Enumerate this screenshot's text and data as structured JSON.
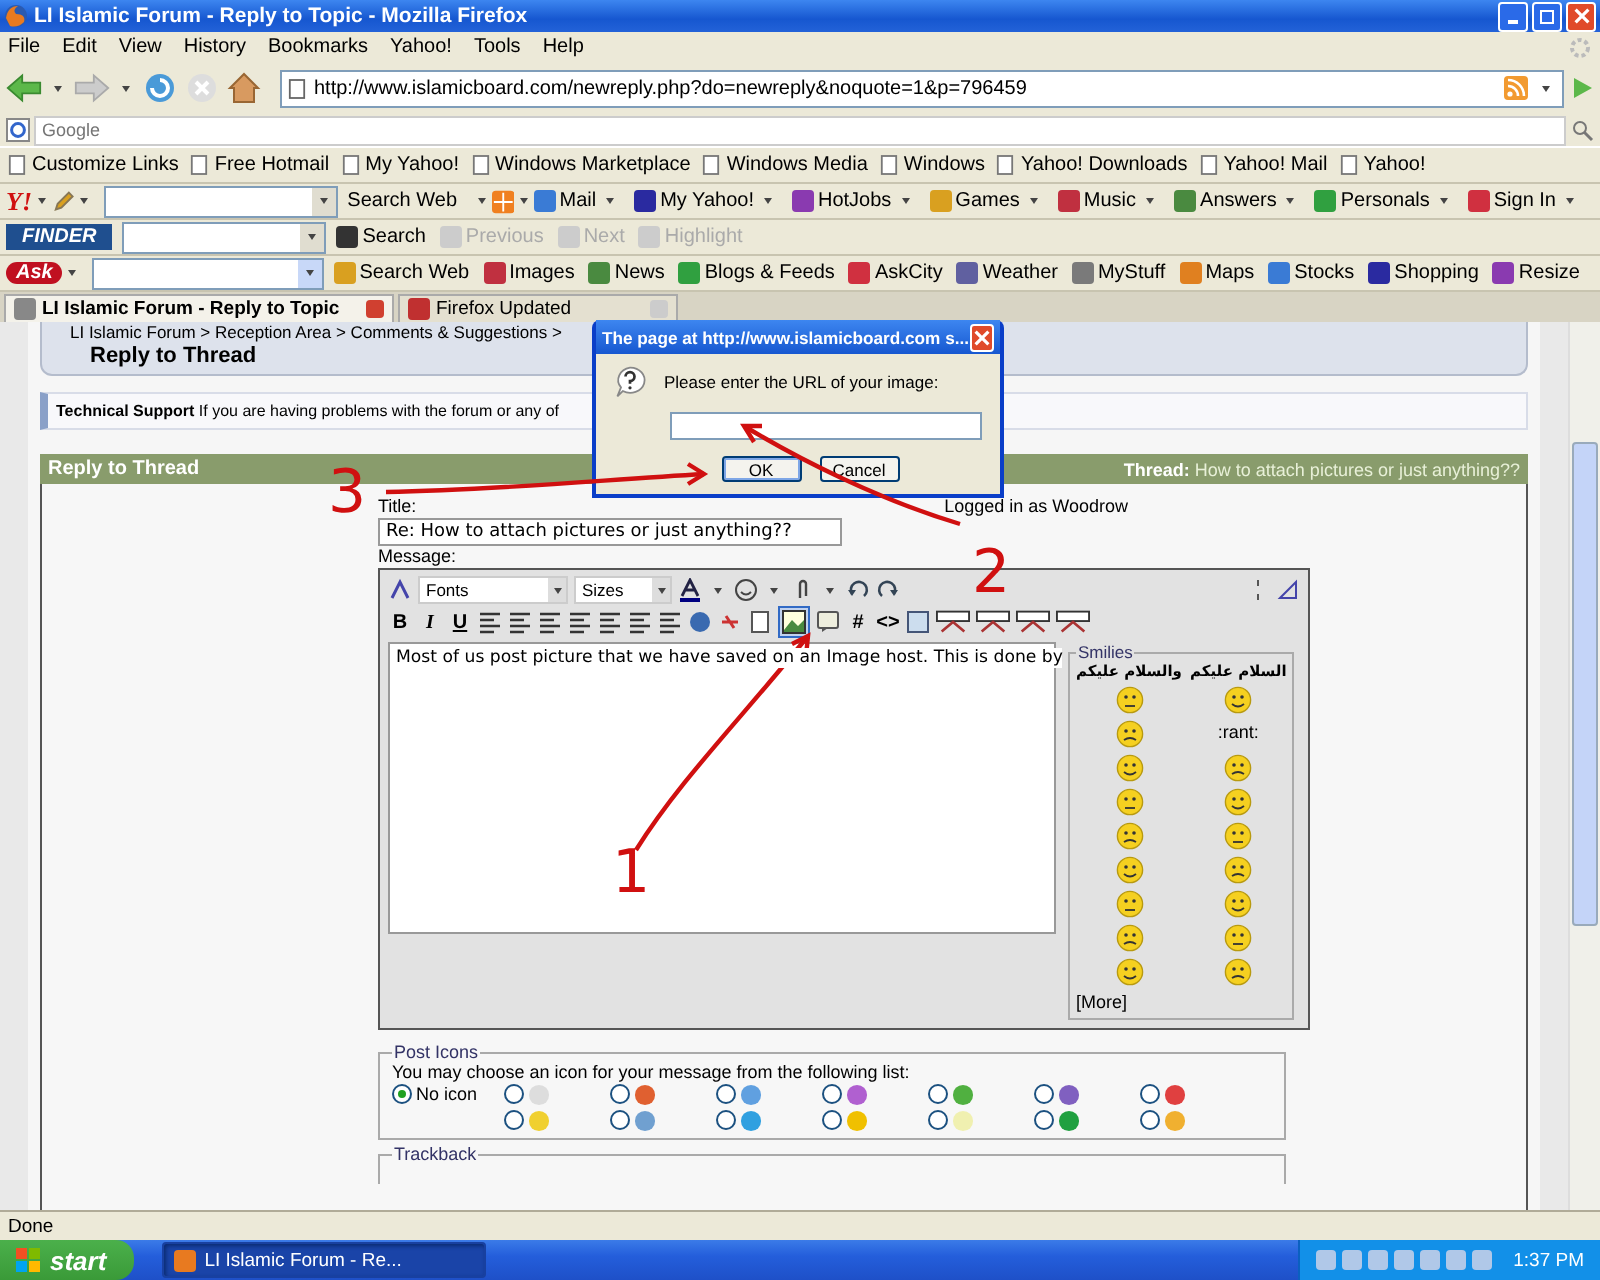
{
  "window": {
    "title": "LI Islamic Forum - Reply to Topic - Mozilla Firefox"
  },
  "menu": [
    "File",
    "Edit",
    "View",
    "History",
    "Bookmarks",
    "Yahoo!",
    "Tools",
    "Help"
  ],
  "address": {
    "value": "http://www.islamicboard.com/newreply.php?do=newreply&noquote=1&p=796459"
  },
  "search": {
    "placeholder": "Google"
  },
  "bookmarks": [
    "Customize Links",
    "Free Hotmail",
    "My Yahoo!",
    "Windows Marketplace",
    "Windows Media",
    "Windows",
    "Yahoo! Downloads",
    "Yahoo! Mail",
    "Yahoo!"
  ],
  "yahoo_toolbar": {
    "logo": "Y!",
    "search_label": "Search Web",
    "items": [
      "Mail",
      "My Yahoo!",
      "HotJobs",
      "Games",
      "Music",
      "Answers",
      "Personals",
      "Sign In"
    ]
  },
  "finder_toolbar": {
    "logo": "FINDER",
    "items": [
      {
        "label": "Search",
        "disabled": false
      },
      {
        "label": "Previous",
        "disabled": true
      },
      {
        "label": "Next",
        "disabled": true
      },
      {
        "label": "Highlight",
        "disabled": true
      }
    ]
  },
  "ask_toolbar": {
    "logo": "Ask",
    "items": [
      "Search Web",
      "Images",
      "News",
      "Blogs & Feeds",
      "AskCity",
      "Weather",
      "MyStuff",
      "Maps",
      "Stocks",
      "Shopping",
      "Resize"
    ]
  },
  "tabs": [
    {
      "label": "LI Islamic Forum - Reply to Topic",
      "selected": true
    },
    {
      "label": "Firefox Updated",
      "selected": false
    }
  ],
  "page": {
    "breadcrumb": "LI Islamic Forum > Reception Area > Comments & Suggestions >",
    "heading": "Reply to Thread",
    "notice": "**Technical Support** If you are having problems with the forum or any of",
    "form_header": {
      "title": "Reply to Thread",
      "thread_label": "Thread:",
      "thread": "How to attach pictures or just anything??"
    },
    "title_label": "Title:",
    "title_value": "Re: How to attach pictures or just anything??",
    "logged_in": "Logged in as Woodrow",
    "message_label": "Message:",
    "editor": {
      "font": "Fonts",
      "size": "Sizes",
      "format_buttons": [
        "B",
        "I",
        "U"
      ],
      "code_buttons": [
        "#",
        "<>"
      ],
      "image_button": {
        "selected": true
      },
      "text": "Most of us post picture that we have saved on an Image host. This is done by",
      "smilies": {
        "legend": "Smilies",
        "headers": [
          "السلام عليكم",
          "والسلام عليكم"
        ],
        "rows": [
          {
            "cells": [
              {
                "kind": "icon"
              },
              {
                "kind": "icon"
              }
            ]
          },
          {
            "cells": [
              {
                "kind": "text",
                "text": ":rant:"
              },
              {
                "kind": "icon"
              }
            ]
          },
          {
            "cells": [
              {
                "kind": "icon"
              },
              {
                "kind": "icon"
              }
            ]
          },
          {
            "cells": [
              {
                "kind": "icon"
              },
              {
                "kind": "icon"
              }
            ]
          },
          {
            "cells": [
              {
                "kind": "icon"
              },
              {
                "kind": "icon"
              }
            ]
          },
          {
            "cells": [
              {
                "kind": "icon"
              },
              {
                "kind": "icon"
              }
            ]
          },
          {
            "cells": [
              {
                "kind": "icon"
              },
              {
                "kind": "icon"
              }
            ]
          },
          {
            "cells": [
              {
                "kind": "icon"
              },
              {
                "kind": "icon"
              }
            ]
          },
          {
            "cells": [
              {
                "kind": "icon"
              },
              {
                "kind": "icon"
              }
            ]
          }
        ],
        "more": "[More]"
      }
    },
    "post_icons": {
      "legend": "Post Icons",
      "hint": "You may choose an icon for your message from the following list:",
      "options": [
        {
          "kind": "none",
          "label": "No icon",
          "selected": true
        },
        {
          "kind": "icon",
          "color": "#dddddd",
          "selected": false
        },
        {
          "kind": "icon",
          "color": "#e06030",
          "selected": false
        },
        {
          "kind": "icon",
          "color": "#60a0e0",
          "selected": false
        },
        {
          "kind": "icon",
          "color": "#b060d0",
          "selected": false
        },
        {
          "kind": "icon",
          "color": "#50b040",
          "selected": false
        },
        {
          "kind": "icon",
          "color": "#8060c0",
          "selected": false
        },
        {
          "kind": "icon",
          "color": "#e04040",
          "selected": false
        },
        {
          "kind": "icon",
          "color": "#f0d030",
          "selected": false
        },
        {
          "kind": "icon",
          "color": "#70a0d0",
          "selected": false
        },
        {
          "kind": "icon",
          "color": "#30a0e0",
          "selected": false
        },
        {
          "kind": "icon",
          "color": "#f0c000",
          "selected": false
        },
        {
          "kind": "icon",
          "color": "#f0f0b0",
          "selected": false
        },
        {
          "kind": "icon",
          "color": "#20a040",
          "selected": false
        },
        {
          "kind": "icon",
          "color": "#f0b030",
          "selected": false
        }
      ]
    },
    "trackback": {
      "legend": "Trackback"
    }
  },
  "dialog": {
    "title": "The page at http://www.islamicboard.com s...",
    "message": "Please enter the URL of your image:",
    "buttons": [
      "OK",
      "Cancel"
    ]
  },
  "annotations": [
    {
      "label": "1"
    },
    {
      "label": "2"
    },
    {
      "label": "3"
    }
  ],
  "status_bar": {
    "text": "Done"
  },
  "taskbar": {
    "start": "start",
    "tasks": [
      {
        "label": "LI Islamic Forum - Re...",
        "selected": true
      }
    ],
    "clock": "1:37 PM"
  }
}
